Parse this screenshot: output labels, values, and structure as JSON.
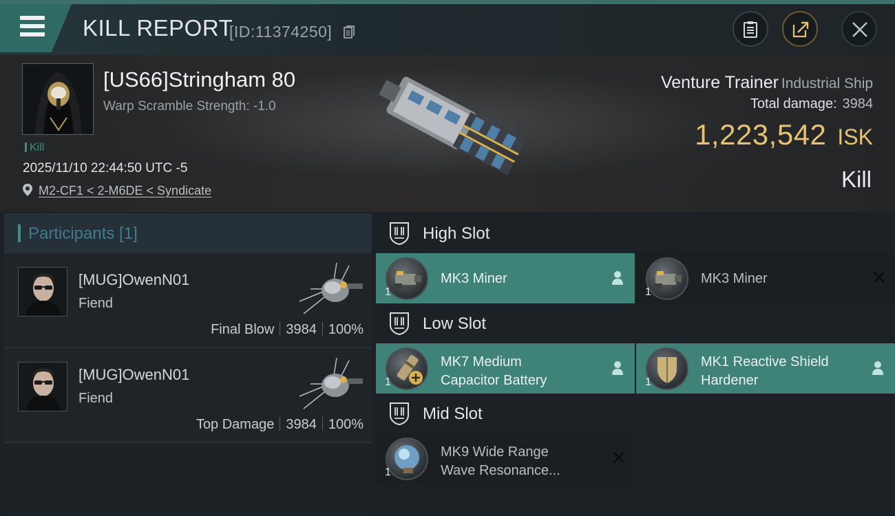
{
  "header": {
    "title": "KILL REPORT",
    "report_id": "[ID:11374250]",
    "menu_icon": "hamburger-menu-icon",
    "notes_icon": "clipboard-icon",
    "share_icon": "share-icon",
    "close_icon": "close-icon"
  },
  "victim": {
    "name": "[US66]Stringham 80",
    "warp_scramble": "Warp Scramble Strength: -1.0",
    "tag": "Kill",
    "timestamp": "2025/11/10 22:44:50 UTC -5",
    "location": "M2-CF1 < 2-M6DE < Syndicate"
  },
  "ship": {
    "name": "Venture Trainer",
    "class": "Industrial Ship",
    "total_damage_label": "Total damage:",
    "total_damage": "3984",
    "isk_value": "1,223,542",
    "isk_unit": "ISK",
    "report_type": "Kill"
  },
  "participants": {
    "title": "Participants [1]",
    "rows": [
      {
        "name": "[MUG]OwenN01",
        "ship": "Fiend",
        "role": "Final Blow",
        "damage": "3984",
        "percent": "100%"
      },
      {
        "name": "[MUG]OwenN01",
        "ship": "Fiend",
        "role": "Top Damage",
        "damage": "3984",
        "percent": "100%"
      }
    ]
  },
  "slots": {
    "high": {
      "title": "High Slot",
      "modules": [
        {
          "name": "MK3 Miner",
          "qty": "1",
          "status": "fitted"
        },
        {
          "name": "MK3 Miner",
          "qty": "1",
          "status": "destroyed"
        }
      ]
    },
    "low": {
      "title": "Low Slot",
      "modules": [
        {
          "name_line1": "MK7 Medium",
          "name_line2": "Capacitor Battery",
          "qty": "1",
          "status": "fitted"
        },
        {
          "name_line1": "MK1 Reactive Shield",
          "name_line2": "Hardener",
          "qty": "1",
          "status": "fitted"
        }
      ]
    },
    "mid": {
      "title": "Mid Slot",
      "modules": [
        {
          "name_line1": "MK9 Wide Range",
          "name_line2": "Wave Resonance...",
          "qty": "1",
          "status": "destroyed"
        }
      ]
    }
  },
  "colors": {
    "accent_teal": "#3f8278",
    "isk_gold": "#e7c274",
    "participants_title": "#3f7d8e"
  }
}
